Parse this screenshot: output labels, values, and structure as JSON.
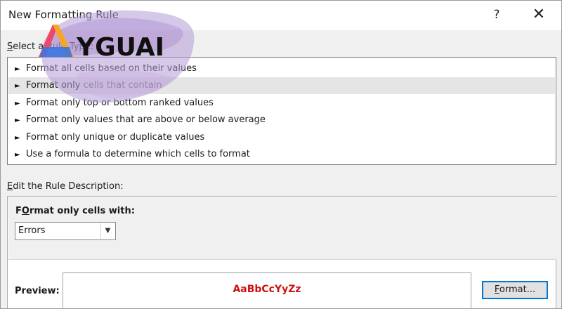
{
  "window": {
    "title": "New Formatting Rule",
    "help_label": "?",
    "close_label": "✕"
  },
  "rule_type": {
    "label_mnemonic": "S",
    "label_rest": "elect a Rule Type:",
    "items": [
      {
        "label": "Format all cells based on their values",
        "selected": false
      },
      {
        "label": "Format only cells that contain",
        "selected": true
      },
      {
        "label": "Format only top or bottom ranked values",
        "selected": false
      },
      {
        "label": "Format only values that are above or below average",
        "selected": false
      },
      {
        "label": "Format only unique or duplicate values",
        "selected": false
      },
      {
        "label": "Use a formula to determine which cells to format",
        "selected": false
      }
    ]
  },
  "description": {
    "label_mnemonic": "E",
    "label_rest": "dit the Rule Description:",
    "title_mnemonic": "O",
    "title_before": "F",
    "title_after": "rmat only cells with:",
    "condition_value": "Errors",
    "preview_label": "Preview:",
    "preview_sample": "AaBbCcYyZz",
    "format_button_mnemonic": "F",
    "format_button_rest": "ormat..."
  },
  "watermark": {
    "text": "YGUAI"
  },
  "colors": {
    "preview_text": "#d01010",
    "selection": "#e5e5e5",
    "button_focus": "#0078d7"
  }
}
